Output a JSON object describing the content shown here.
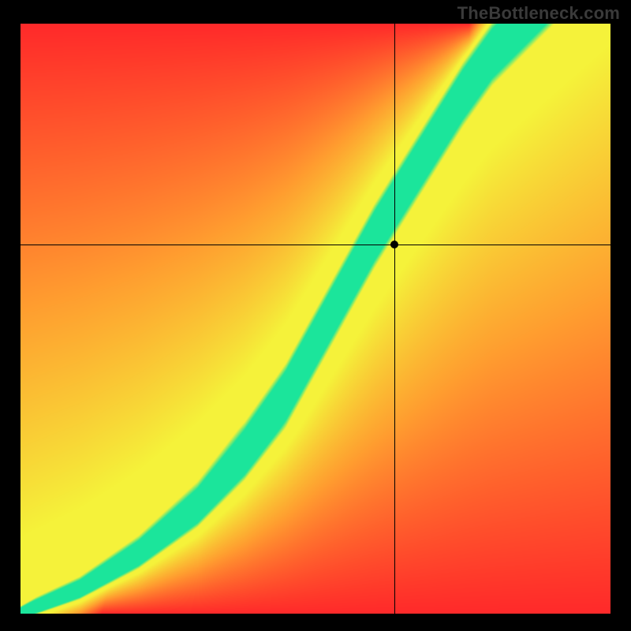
{
  "watermark": "TheBottleneck.com",
  "chart_data": {
    "type": "heatmap",
    "title": "",
    "xlabel": "",
    "ylabel": "",
    "xlim": [
      0,
      1
    ],
    "ylim": [
      0,
      1
    ],
    "crosshair": {
      "x": 0.635,
      "y": 0.625
    },
    "marker": {
      "x": 0.635,
      "y": 0.625
    },
    "ridge_points": [
      {
        "x": 0.0,
        "y": 0.0
      },
      {
        "x": 0.1,
        "y": 0.04
      },
      {
        "x": 0.2,
        "y": 0.1
      },
      {
        "x": 0.3,
        "y": 0.18
      },
      {
        "x": 0.38,
        "y": 0.27
      },
      {
        "x": 0.45,
        "y": 0.37
      },
      {
        "x": 0.5,
        "y": 0.46
      },
      {
        "x": 0.55,
        "y": 0.55
      },
      {
        "x": 0.6,
        "y": 0.64
      },
      {
        "x": 0.65,
        "y": 0.72
      },
      {
        "x": 0.7,
        "y": 0.8
      },
      {
        "x": 0.75,
        "y": 0.88
      },
      {
        "x": 0.8,
        "y": 0.95
      },
      {
        "x": 0.85,
        "y": 1.0
      }
    ],
    "ridge_width": 0.05,
    "colors": {
      "ridge": "#1BE59B",
      "near": "#F5F23A",
      "far_topleft": "#FF2A2A",
      "far_bottomright": "#FF2A2A",
      "mid": "#FFA030"
    }
  }
}
